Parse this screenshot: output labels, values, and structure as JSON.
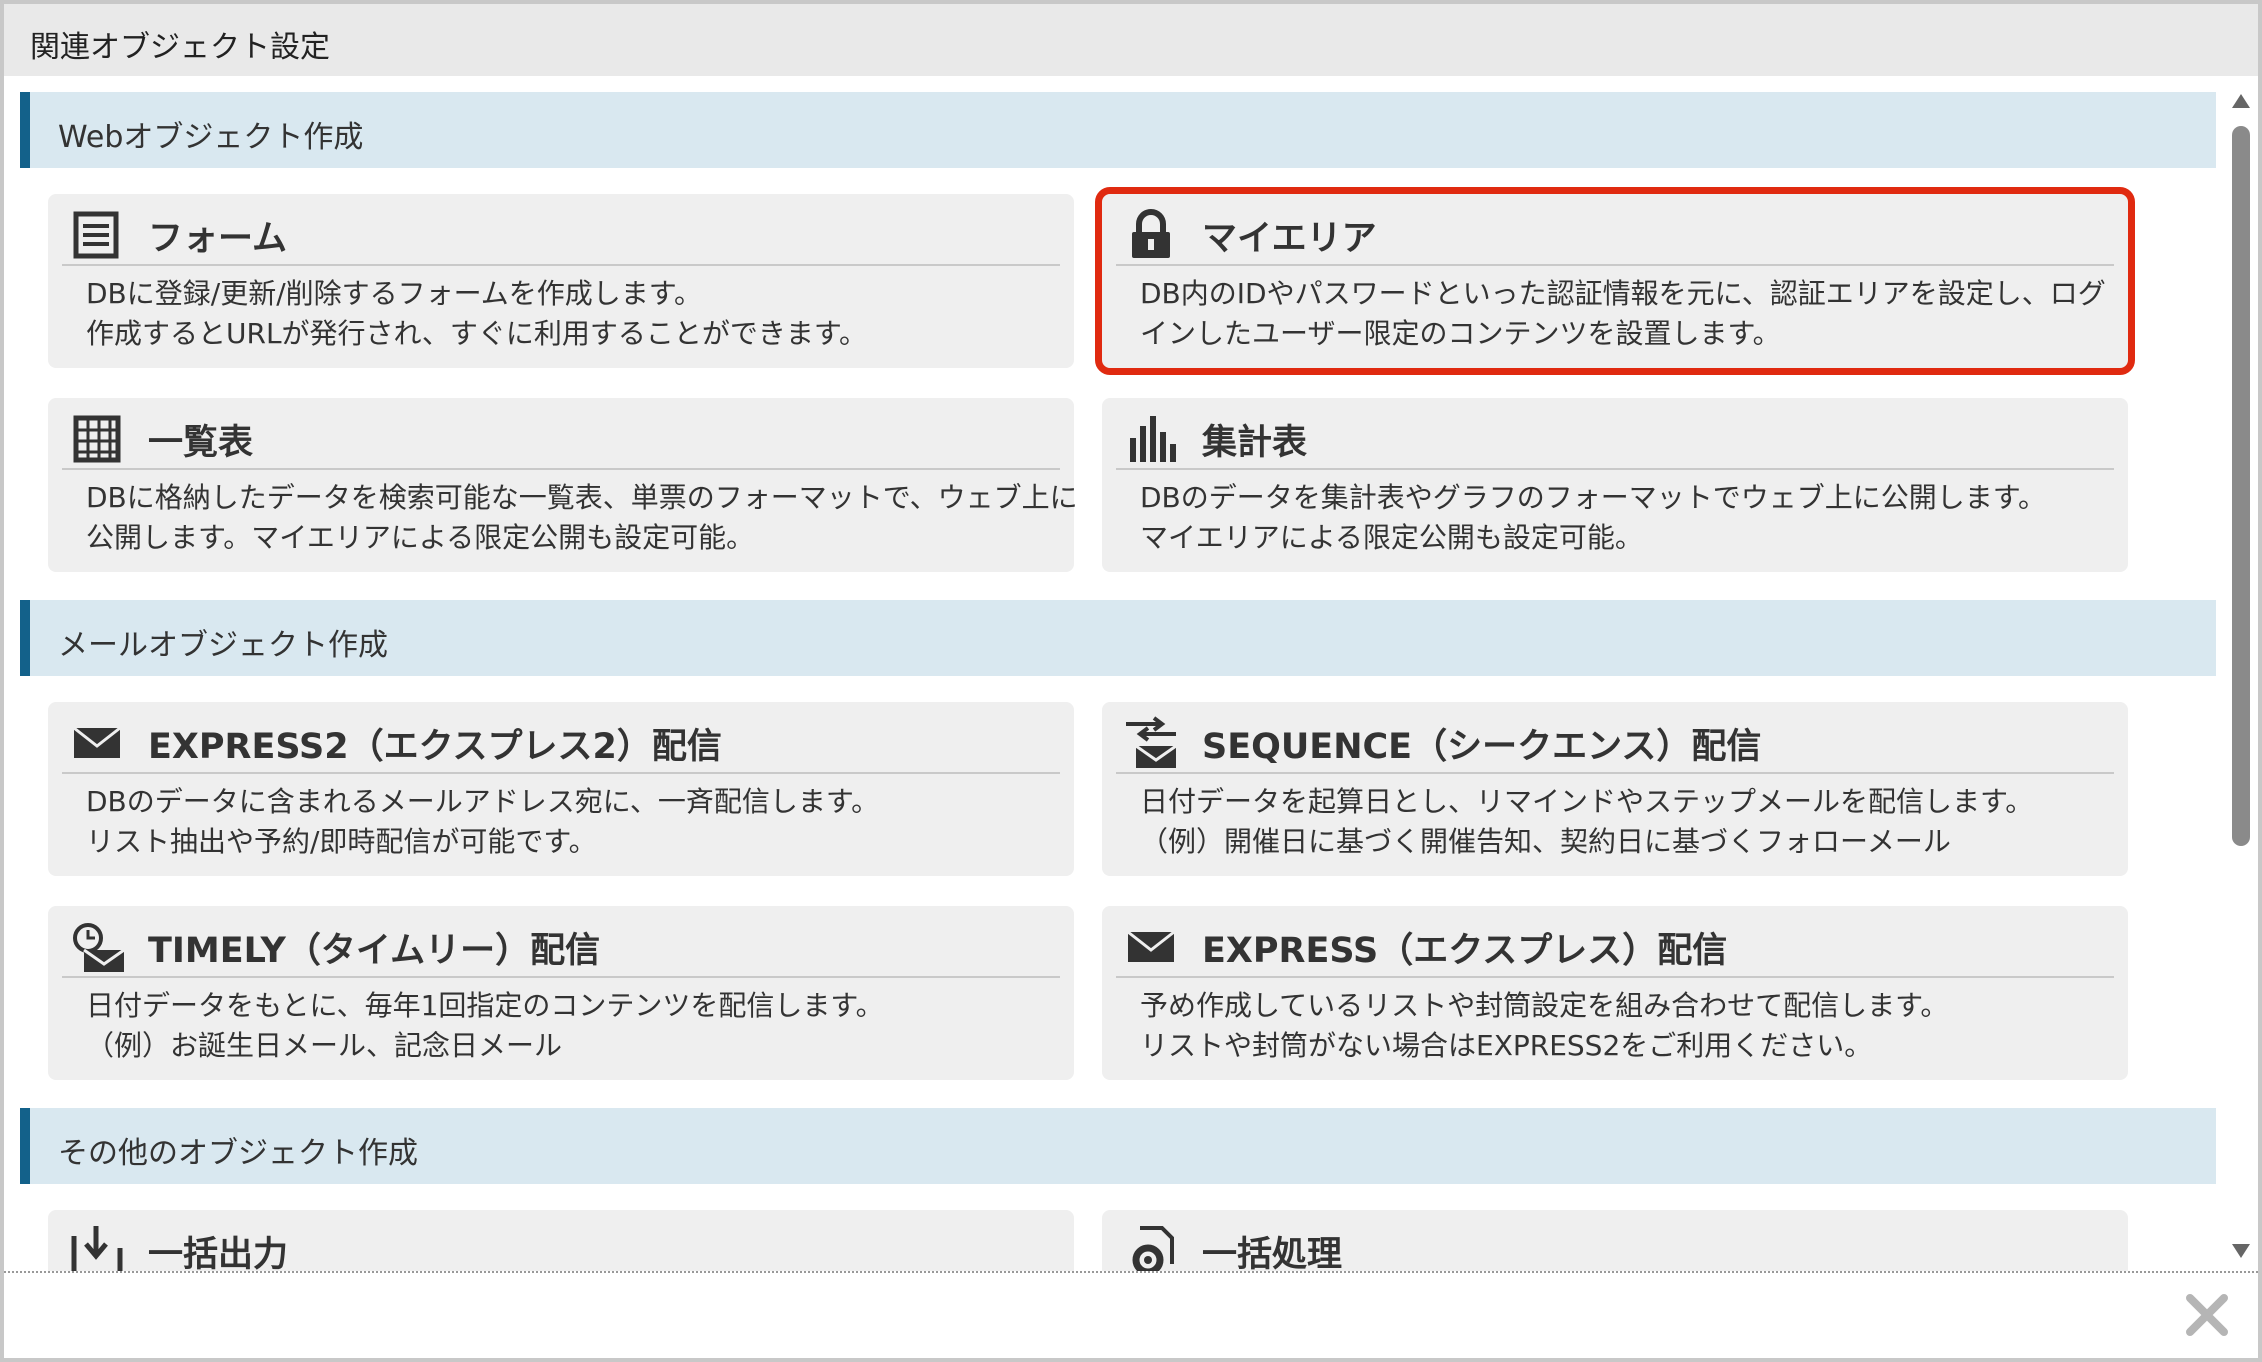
{
  "dialog": {
    "title": "関連オブジェクト設定"
  },
  "sections": {
    "web": {
      "header": "Webオブジェクト作成",
      "form": {
        "icon": "form-list-icon",
        "title": "フォーム",
        "desc": [
          "DBに登録/更新/削除するフォームを作成します。",
          "作成するとURLが発行され、すぐに利用することができます。"
        ]
      },
      "myarea": {
        "icon": "lock-icon",
        "title": "マイエリア",
        "desc": [
          "DB内のIDやパスワードといった認証情報を元に、認証エリアを設定し、ログ",
          "インしたユーザー限定のコンテンツを設置します。"
        ]
      },
      "list": {
        "icon": "grid-table-icon",
        "title": "一覧表",
        "desc": [
          "DBに格納したデータを検索可能な一覧表、単票のフォーマットで、ウェブ上に",
          "公開します。マイエリアによる限定公開も設定可能。"
        ]
      },
      "summary": {
        "icon": "bar-chart-icon",
        "title": "集計表",
        "desc": [
          "DBのデータを集計表やグラフのフォーマットでウェブ上に公開します。",
          "マイエリアによる限定公開も設定可能。"
        ]
      }
    },
    "mail": {
      "header": "メールオブジェクト作成",
      "express2": {
        "icon": "envelope-icon",
        "title": "EXPRESS2（エクスプレス2）配信",
        "desc": [
          "DBのデータに含まれるメールアドレス宛に、一斉配信します。",
          "リスト抽出や予約/即時配信が可能です。"
        ]
      },
      "sequence": {
        "icon": "sequence-mail-icon",
        "title": "SEQUENCE（シークエンス）配信",
        "desc": [
          "日付データを起算日とし、リマインドやステップメールを配信します。",
          "（例）開催日に基づく開催告知、契約日に基づくフォローメール"
        ]
      },
      "timely": {
        "icon": "clock-mail-icon",
        "title": "TIMELY（タイムリー）配信",
        "desc": [
          "日付データをもとに、毎年1回指定のコンテンツを配信します。",
          "（例）お誕生日メール、記念日メール"
        ]
      },
      "express": {
        "icon": "envelope-icon",
        "title": "EXPRESS（エクスプレス）配信",
        "desc": [
          "予め作成しているリストや封筒設定を組み合わせて配信します。",
          "リストや封筒がない場合はEXPRESS2をご利用ください。"
        ]
      }
    },
    "other": {
      "header": "その他のオブジェクト作成",
      "export": {
        "icon": "export-download-icon",
        "title": "一括出力"
      },
      "batch": {
        "icon": "gear-doc-icon",
        "title": "一括処理"
      }
    }
  },
  "colors": {
    "accent": "#13618a",
    "section_bg": "#d9e8f0",
    "highlight": "#e02a10",
    "card_bg": "#efefef"
  },
  "footer": {
    "close_icon": "close-icon"
  }
}
